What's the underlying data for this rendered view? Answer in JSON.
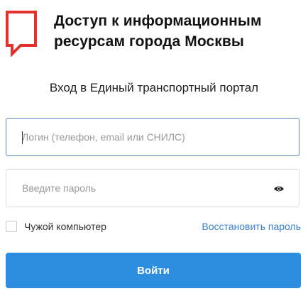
{
  "header": {
    "logo_icon": "mos-ru-logo-icon",
    "logo_color": "#e3312d",
    "title_line1": "Доступ к информационным",
    "title_line2": "ресурсам города Москвы"
  },
  "portal_title": "Вход в Единый транспортный портал",
  "login": {
    "placeholder": "Логин (телефон, email или СНИЛС)",
    "value": ""
  },
  "password": {
    "placeholder": "Введите пароль",
    "value": "",
    "toggle_icon": "eye-icon"
  },
  "foreign_computer": {
    "label": "Чужой компьютер",
    "checked": false
  },
  "restore_password_label": "Восстановить пароль",
  "login_button_label": "Войти",
  "colors": {
    "accent": "#2d8ee0",
    "link": "#3a7fc9",
    "focused_border": "#5a86b8"
  }
}
